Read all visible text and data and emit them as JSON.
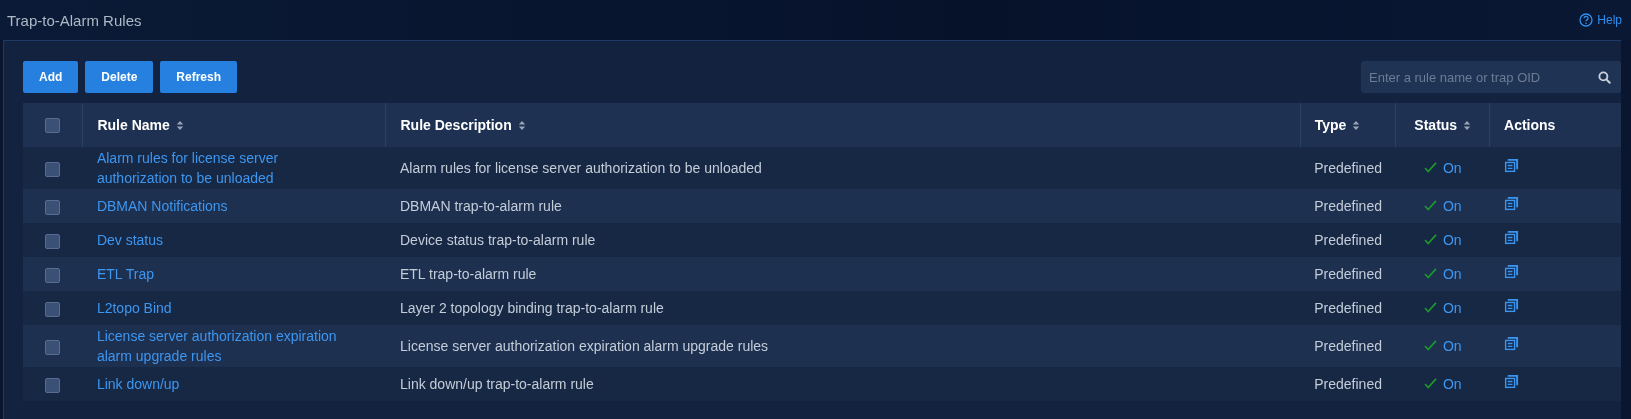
{
  "page": {
    "title": "Trap-to-Alarm Rules",
    "help": "Help"
  },
  "toolbar": {
    "buttons": [
      "Add",
      "Delete",
      "Refresh"
    ],
    "search": {
      "placeholder": "Enter a rule name or trap OID"
    }
  },
  "table": {
    "select_all": {
      "checked": false
    },
    "columns": [
      {
        "label": "Rule Name",
        "sortable": true
      },
      {
        "label": "Rule Description",
        "sortable": true
      },
      {
        "label": "Type",
        "sortable": true
      },
      {
        "label": "Status",
        "sortable": true
      },
      {
        "label": "Actions",
        "sortable": false
      }
    ],
    "rows": [
      {
        "checked": false,
        "name": "Alarm rules for license server authorization to be unloaded",
        "description": "Alarm rules for license server authorization to be unloaded",
        "type": "Predefined",
        "status": "On",
        "on": true
      },
      {
        "checked": false,
        "name": "DBMAN Notifications",
        "description": "DBMAN trap-to-alarm rule",
        "type": "Predefined",
        "status": "On",
        "on": true
      },
      {
        "checked": false,
        "name": "Dev status",
        "description": "Device status trap-to-alarm rule",
        "type": "Predefined",
        "status": "On",
        "on": true
      },
      {
        "checked": false,
        "name": "ETL Trap",
        "description": "ETL trap-to-alarm rule",
        "type": "Predefined",
        "status": "On",
        "on": true
      },
      {
        "checked": false,
        "name": "L2topo Bind",
        "description": "Layer 2 topology binding trap-to-alarm rule",
        "type": "Predefined",
        "status": "On",
        "on": true
      },
      {
        "checked": false,
        "name": "License server authorization expiration alarm upgrade rules",
        "description": "License server authorization expiration alarm upgrade rules",
        "type": "Predefined",
        "status": "On",
        "on": true
      },
      {
        "checked": false,
        "name": "Link down/up",
        "description": "Link down/up trap-to-alarm rule",
        "type": "Predefined",
        "status": "On",
        "on": true
      }
    ]
  }
}
